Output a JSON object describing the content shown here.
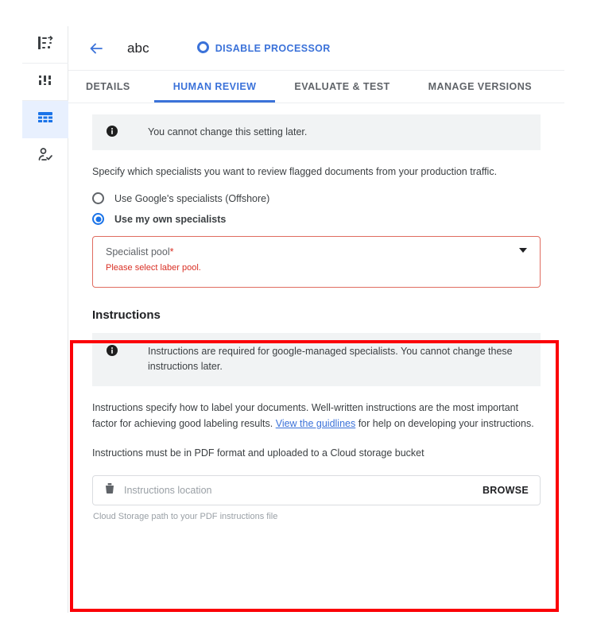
{
  "sidebar": {
    "items": [
      {
        "icon": "workflow-icon",
        "active": false
      },
      {
        "icon": "bar-chart-icon",
        "active": false
      },
      {
        "icon": "table-grid-icon",
        "active": true
      },
      {
        "icon": "person-check-icon",
        "active": false
      }
    ]
  },
  "header": {
    "back_label": "back-arrow",
    "title": "abc",
    "action_icon": "stop-circle-icon",
    "action_label": "DISABLE PROCESSOR"
  },
  "tabs": [
    {
      "label": "DETAILS",
      "active": false
    },
    {
      "label": "HUMAN REVIEW",
      "active": true
    },
    {
      "label": "EVALUATE & TEST",
      "active": false
    },
    {
      "label": "MANAGE VERSIONS",
      "active": false
    }
  ],
  "human_review": {
    "banner_text": "You cannot change this setting later.",
    "description": "Specify which specialists you want to review flagged documents from your production traffic.",
    "options": [
      {
        "label": "Use Google's specialists (Offshore)",
        "selected": false
      },
      {
        "label": "Use my own specialists",
        "selected": true
      }
    ],
    "specialist_pool": {
      "label": "Specialist pool",
      "required_marker": "*",
      "error": "Please select laber pool.",
      "value": ""
    }
  },
  "instructions": {
    "title": "Instructions",
    "banner_text": "Instructions are required for google-managed specialists. You cannot change these instructions later.",
    "body_before_link": "Instructions specify how to label your documents. Well-written instructions are the most important factor for achieving good labeling results. ",
    "link_text": "View the guidlines",
    "body_after_link": " for help on developing your instructions.",
    "format_note": "Instructions must be in PDF format and uploaded to a Cloud storage bucket",
    "location_placeholder": "Instructions location",
    "browse_label": "BROWSE",
    "helper_text": "Cloud Storage path to your PDF instructions file"
  },
  "annotation": {
    "color": "#fb0007"
  }
}
